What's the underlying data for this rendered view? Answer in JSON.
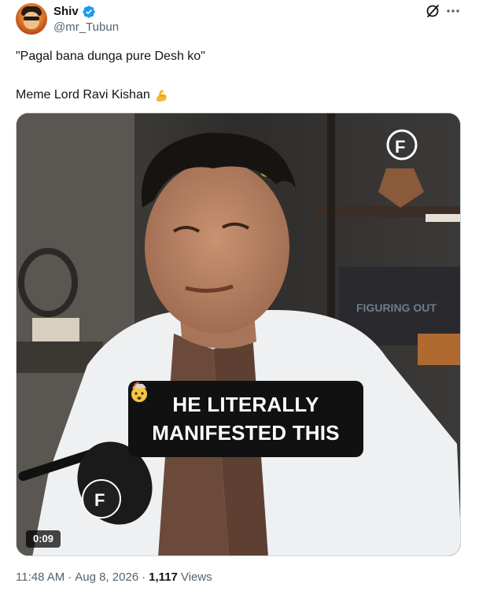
{
  "author": {
    "name": "Shiv",
    "handle": "@mr_Tubun",
    "verified": true
  },
  "tweet": {
    "line1": "\"Pagal bana dunga pure Desh ko\"",
    "line2": "Meme Lord Ravi Kishan",
    "line2_emoji": "flexed-biceps"
  },
  "media": {
    "caption_line1": "HE LITERALLY",
    "caption_line2": "MANIFESTED THIS",
    "caption_emoji": "exploding-head",
    "duration": "0:09"
  },
  "meta": {
    "time": "11:48 AM",
    "separator": "·",
    "date": "Aug 8, 2026",
    "views_count": "1,117",
    "views_label": "Views"
  },
  "colors": {
    "verified_blue": "#1d9bf0",
    "secondary_text": "#536471"
  }
}
